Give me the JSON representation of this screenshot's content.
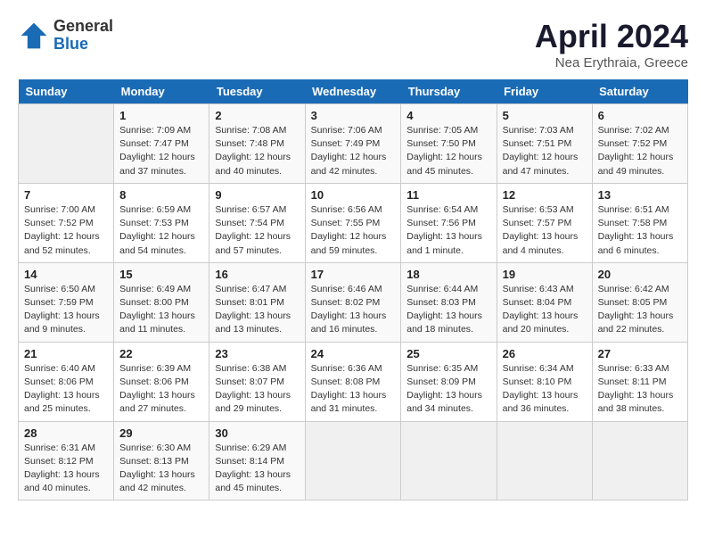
{
  "header": {
    "logo_general": "General",
    "logo_blue": "Blue",
    "title": "April 2024",
    "subtitle": "Nea Erythraia, Greece"
  },
  "days_of_week": [
    "Sunday",
    "Monday",
    "Tuesday",
    "Wednesday",
    "Thursday",
    "Friday",
    "Saturday"
  ],
  "weeks": [
    [
      {
        "day": "",
        "info": ""
      },
      {
        "day": "1",
        "info": "Sunrise: 7:09 AM\nSunset: 7:47 PM\nDaylight: 12 hours\nand 37 minutes."
      },
      {
        "day": "2",
        "info": "Sunrise: 7:08 AM\nSunset: 7:48 PM\nDaylight: 12 hours\nand 40 minutes."
      },
      {
        "day": "3",
        "info": "Sunrise: 7:06 AM\nSunset: 7:49 PM\nDaylight: 12 hours\nand 42 minutes."
      },
      {
        "day": "4",
        "info": "Sunrise: 7:05 AM\nSunset: 7:50 PM\nDaylight: 12 hours\nand 45 minutes."
      },
      {
        "day": "5",
        "info": "Sunrise: 7:03 AM\nSunset: 7:51 PM\nDaylight: 12 hours\nand 47 minutes."
      },
      {
        "day": "6",
        "info": "Sunrise: 7:02 AM\nSunset: 7:52 PM\nDaylight: 12 hours\nand 49 minutes."
      }
    ],
    [
      {
        "day": "7",
        "info": "Sunrise: 7:00 AM\nSunset: 7:52 PM\nDaylight: 12 hours\nand 52 minutes."
      },
      {
        "day": "8",
        "info": "Sunrise: 6:59 AM\nSunset: 7:53 PM\nDaylight: 12 hours\nand 54 minutes."
      },
      {
        "day": "9",
        "info": "Sunrise: 6:57 AM\nSunset: 7:54 PM\nDaylight: 12 hours\nand 57 minutes."
      },
      {
        "day": "10",
        "info": "Sunrise: 6:56 AM\nSunset: 7:55 PM\nDaylight: 12 hours\nand 59 minutes."
      },
      {
        "day": "11",
        "info": "Sunrise: 6:54 AM\nSunset: 7:56 PM\nDaylight: 13 hours\nand 1 minute."
      },
      {
        "day": "12",
        "info": "Sunrise: 6:53 AM\nSunset: 7:57 PM\nDaylight: 13 hours\nand 4 minutes."
      },
      {
        "day": "13",
        "info": "Sunrise: 6:51 AM\nSunset: 7:58 PM\nDaylight: 13 hours\nand 6 minutes."
      }
    ],
    [
      {
        "day": "14",
        "info": "Sunrise: 6:50 AM\nSunset: 7:59 PM\nDaylight: 13 hours\nand 9 minutes."
      },
      {
        "day": "15",
        "info": "Sunrise: 6:49 AM\nSunset: 8:00 PM\nDaylight: 13 hours\nand 11 minutes."
      },
      {
        "day": "16",
        "info": "Sunrise: 6:47 AM\nSunset: 8:01 PM\nDaylight: 13 hours\nand 13 minutes."
      },
      {
        "day": "17",
        "info": "Sunrise: 6:46 AM\nSunset: 8:02 PM\nDaylight: 13 hours\nand 16 minutes."
      },
      {
        "day": "18",
        "info": "Sunrise: 6:44 AM\nSunset: 8:03 PM\nDaylight: 13 hours\nand 18 minutes."
      },
      {
        "day": "19",
        "info": "Sunrise: 6:43 AM\nSunset: 8:04 PM\nDaylight: 13 hours\nand 20 minutes."
      },
      {
        "day": "20",
        "info": "Sunrise: 6:42 AM\nSunset: 8:05 PM\nDaylight: 13 hours\nand 22 minutes."
      }
    ],
    [
      {
        "day": "21",
        "info": "Sunrise: 6:40 AM\nSunset: 8:06 PM\nDaylight: 13 hours\nand 25 minutes."
      },
      {
        "day": "22",
        "info": "Sunrise: 6:39 AM\nSunset: 8:06 PM\nDaylight: 13 hours\nand 27 minutes."
      },
      {
        "day": "23",
        "info": "Sunrise: 6:38 AM\nSunset: 8:07 PM\nDaylight: 13 hours\nand 29 minutes."
      },
      {
        "day": "24",
        "info": "Sunrise: 6:36 AM\nSunset: 8:08 PM\nDaylight: 13 hours\nand 31 minutes."
      },
      {
        "day": "25",
        "info": "Sunrise: 6:35 AM\nSunset: 8:09 PM\nDaylight: 13 hours\nand 34 minutes."
      },
      {
        "day": "26",
        "info": "Sunrise: 6:34 AM\nSunset: 8:10 PM\nDaylight: 13 hours\nand 36 minutes."
      },
      {
        "day": "27",
        "info": "Sunrise: 6:33 AM\nSunset: 8:11 PM\nDaylight: 13 hours\nand 38 minutes."
      }
    ],
    [
      {
        "day": "28",
        "info": "Sunrise: 6:31 AM\nSunset: 8:12 PM\nDaylight: 13 hours\nand 40 minutes."
      },
      {
        "day": "29",
        "info": "Sunrise: 6:30 AM\nSunset: 8:13 PM\nDaylight: 13 hours\nand 42 minutes."
      },
      {
        "day": "30",
        "info": "Sunrise: 6:29 AM\nSunset: 8:14 PM\nDaylight: 13 hours\nand 45 minutes."
      },
      {
        "day": "",
        "info": ""
      },
      {
        "day": "",
        "info": ""
      },
      {
        "day": "",
        "info": ""
      },
      {
        "day": "",
        "info": ""
      }
    ]
  ]
}
